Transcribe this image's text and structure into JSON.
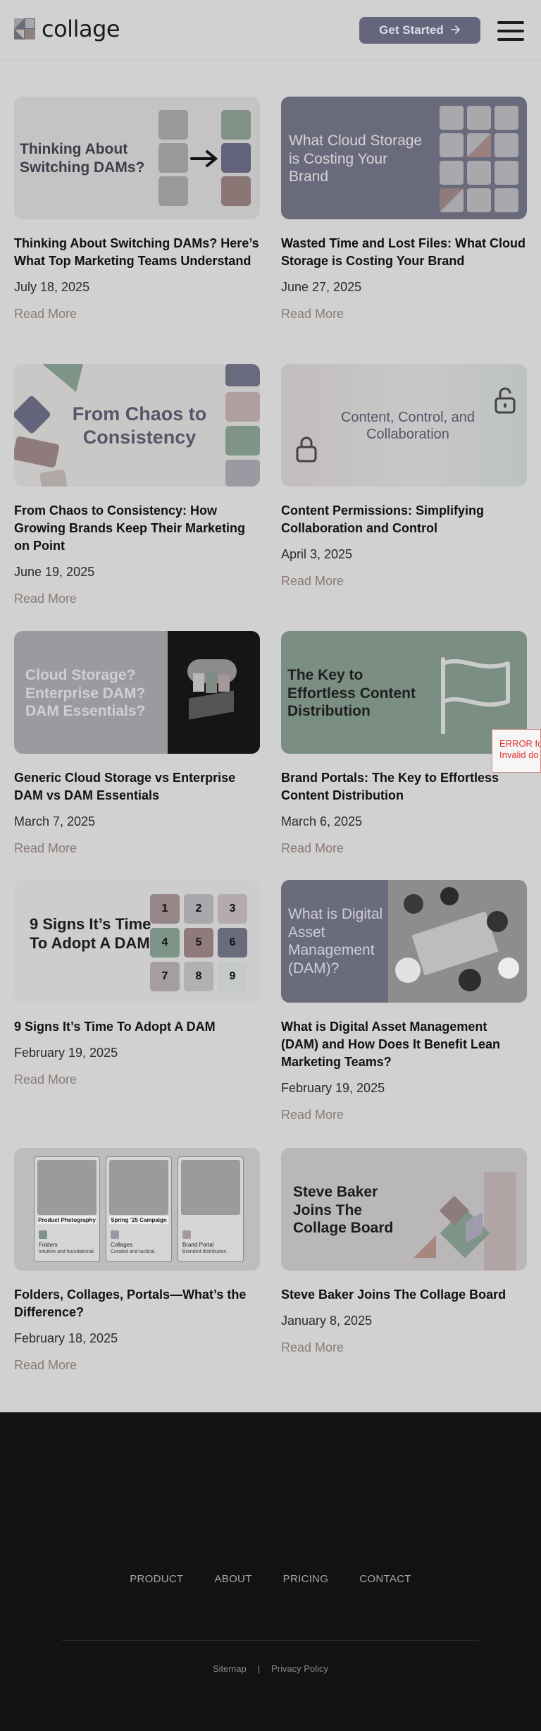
{
  "header": {
    "logo_text": "collage",
    "cta_label": "Get Started",
    "cta_icon": "arrow-right-icon",
    "menu_icon": "hamburger-menu-icon"
  },
  "posts": [
    {
      "title": "Thinking About Switching DAMs? Here’s What Top Marketing Teams Understand",
      "date": "July 18, 2025",
      "read_more": "Read More",
      "thumb_text": "Thinking About Switching DAMs?"
    },
    {
      "title": "Wasted Time and Lost Files: What Cloud Storage is Costing Your Brand",
      "date": "June 27, 2025",
      "read_more": "Read More",
      "thumb_text": "What Cloud Storage is Costing Your Brand"
    },
    {
      "title": "From Chaos to Consistency: How Growing Brands Keep Their Marketing on Point",
      "date": "June 19, 2025",
      "read_more": "Read More",
      "thumb_text": "From Chaos to Consistency"
    },
    {
      "title": "Content Permissions: Simplifying Collaboration and Control",
      "date": "April 3, 2025",
      "read_more": "Read More",
      "thumb_text": "Content, Control, and Collaboration"
    },
    {
      "title": "Generic Cloud Storage vs Enterprise DAM vs DAM Essentials",
      "date": "March 7, 2025",
      "read_more": "Read More",
      "thumb_text": "Cloud Storage? Enterprise DAM? DAM Essentials?"
    },
    {
      "title": "Brand Portals: The Key to Effortless Content Distribution",
      "date": "March 6, 2025",
      "read_more": "Read More",
      "thumb_text": "The Key to Effortless Content Distribution"
    },
    {
      "title": "9 Signs It’s Time To Adopt A DAM",
      "date": "February 19, 2025",
      "read_more": "Read More",
      "thumb_text": "9 Signs It’s Time To Adopt A DAM",
      "thumb_numbers": [
        "1",
        "2",
        "3",
        "4",
        "5",
        "6",
        "7",
        "8",
        "9"
      ]
    },
    {
      "title": "What is Digital Asset Management (DAM) and How Does It Benefit Lean Marketing Teams?",
      "date": "February 19, 2025",
      "read_more": "Read More",
      "thumb_text": "What is Digital Asset Management (DAM)?"
    },
    {
      "title": "Folders, Collages, Portals—What’s the Difference?",
      "date": "February 18, 2025",
      "read_more": "Read More",
      "thumb_labels": [
        "Product Photography",
        "Spring ’25 Campaign",
        "Folders",
        "Intuitive and foundational.",
        "Collages",
        "Curated and tactical.",
        "Brand Portal",
        "Branded distribution."
      ]
    },
    {
      "title": "Steve Baker Joins The Collage Board",
      "date": "January 8, 2025",
      "read_more": "Read More",
      "thumb_text": "Steve Baker Joins The Collage Board"
    }
  ],
  "error_badge": {
    "line1": "ERROR fo",
    "line2": "Invalid do"
  },
  "footer": {
    "nav": [
      "PRODUCT",
      "ABOUT",
      "PRICING",
      "CONTACT"
    ],
    "legal": [
      "Sitemap",
      "Privacy Policy"
    ],
    "separator": "|"
  },
  "colors": {
    "background": "#d1d1d1",
    "accent": "#65667c",
    "read_more": "#8a7b74",
    "footer_bg": "#121212"
  }
}
